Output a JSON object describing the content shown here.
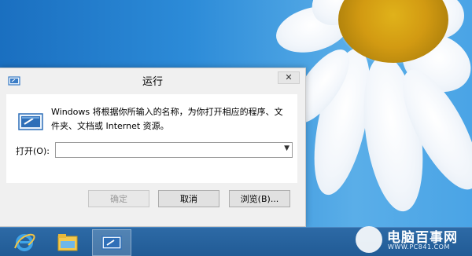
{
  "dialog": {
    "title": "运行",
    "close_label": "✕",
    "description": "Windows 将根据你所输入的名称，为你打开相应的程序、文件夹、文档或 Internet 资源。",
    "open_label": "打开(O):",
    "open_value": "",
    "ok_label": "确定",
    "cancel_label": "取消",
    "browse_label": "浏览(B)..."
  },
  "taskbar": {
    "items": [
      {
        "icon": "internet-explorer-icon"
      },
      {
        "icon": "file-explorer-icon"
      },
      {
        "icon": "run-icon",
        "active": true
      }
    ]
  },
  "watermark": {
    "name": "电脑百事网",
    "url": "WWW.PC841.COM"
  },
  "colors": {
    "taskbar": "#215b95",
    "desktop": "#2c8bd8",
    "dialog_bg": "#f0f0f0",
    "flower_center": "#d29a12"
  }
}
